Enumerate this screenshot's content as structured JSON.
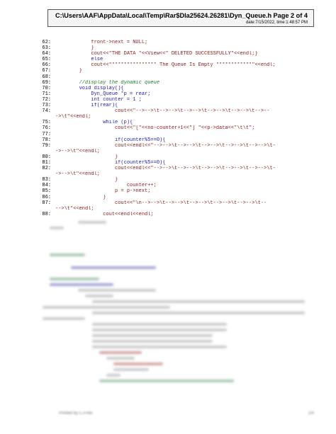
{
  "header": {
    "path": "C:\\Users\\AAF\\AppData\\Local\\Temp\\Rar$DIa25624.26281\\Dyn_Queue.h",
    "page": "Page 2 of 4",
    "date": "date:7/15/2022, time:1:48:57 PM"
  },
  "code_lines": [
    {
      "n": "62:",
      "t": "            front->next = NULL;"
    },
    {
      "n": "63:",
      "t": "            }"
    },
    {
      "n": "64:",
      "t": "            cout<<\"THE DATA \"<<View<<\" DELETED SUCCESSFULLY\"<<endl;}"
    },
    {
      "n": "65:",
      "t": "            else"
    },
    {
      "n": "66:",
      "t": "            cout<<\"*************** The Queue Is Empty ************\"<<endl;"
    },
    {
      "n": "67:",
      "t": "        }"
    },
    {
      "n": "68:",
      "t": ""
    },
    {
      "n": "69:",
      "t": "        //display the dynamic queue"
    },
    {
      "n": "70:",
      "t": "        void display(){"
    },
    {
      "n": "71:",
      "t": "            Dyn_Queue *p = rear;"
    },
    {
      "n": "72:",
      "t": "            int counter = 1 ;"
    },
    {
      "n": "73:",
      "t": "            if(rear){"
    },
    {
      "n": "74:",
      "t": "                    cout<<\"-->-->\\t-->-->\\t-->-->\\t-->-->\\t-->-->\\t-->--"
    },
    {
      "n": "",
      "t": "->\\t\"<<endl;"
    },
    {
      "n": "75:",
      "t": "                while (p){"
    },
    {
      "n": "76:",
      "t": "                    cout<<\"[\"<<no-counter+1<<\"] \"<<p->data<<\"\\t\\t\";"
    },
    {
      "n": "77:",
      "t": ""
    },
    {
      "n": "78:",
      "t": "                    if(counter%5==0){"
    },
    {
      "n": "79:",
      "t": "                    cout<<endl<<\"-->-->\\t-->-->\\t-->-->\\t-->-->\\t-->-->\\t-"
    },
    {
      "n": "",
      "t": "->-->\\t\"<<endl;"
    },
    {
      "n": "80:",
      "t": "                    }"
    },
    {
      "n": "81:",
      "t": "                    if(counter%5==0){"
    },
    {
      "n": "82:",
      "t": "                    cout<<endl<<\"-->-->\\t-->-->\\t-->-->\\t-->-->\\t-->-->\\t-"
    },
    {
      "n": "",
      "t": "->-->\\t\"<<endl;"
    },
    {
      "n": "83:",
      "t": "                    }"
    },
    {
      "n": "84:",
      "t": "                        counter++;"
    },
    {
      "n": "85:",
      "t": "                    p = p->next;"
    },
    {
      "n": "86:",
      "t": "                }"
    },
    {
      "n": "87:",
      "t": "                    cout<<\"\\n-->-->\\t-->-->\\t-->-->\\t-->-->\\t-->-->\\t--"
    },
    {
      "n": "",
      "t": "-->\\t\"<<endl;"
    },
    {
      "n": "88:",
      "t": "                cout<<endl<<endl;"
    }
  ],
  "footer": {
    "left": "Printed by C-Free",
    "right": "2/4"
  }
}
